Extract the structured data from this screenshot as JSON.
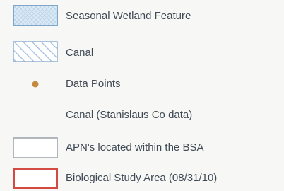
{
  "legend": {
    "items": [
      {
        "label": "Seasonal Wetland Feature",
        "icon": "crosshatch-blue-polygon-icon",
        "fill_color": "#dbe9f5",
        "stroke_color": "#7fa7c9"
      },
      {
        "label": "Canal",
        "icon": "diagonal-hatch-blue-polygon-icon",
        "fill_color": "#ffffff",
        "stroke_color": "#8fb0d0"
      },
      {
        "label": "Data Points",
        "icon": "orange-dot-icon",
        "fill_color": "#c68a3e",
        "stroke_color": "#c68a3e"
      },
      {
        "label": "Canal (Stanislaus Co data)",
        "icon": "blank-icon",
        "fill_color": "#f7f7f5",
        "stroke_color": "#f7f7f5"
      },
      {
        "label": "APN's located within the BSA",
        "icon": "hollow-gray-polygon-icon",
        "fill_color": "#ffffff",
        "stroke_color": "#9ea6ad"
      },
      {
        "label": "Biological Study Area (08/31/10)",
        "icon": "hollow-red-polygon-icon",
        "fill_color": "#ffffff",
        "stroke_color": "#d24a42"
      }
    ]
  }
}
